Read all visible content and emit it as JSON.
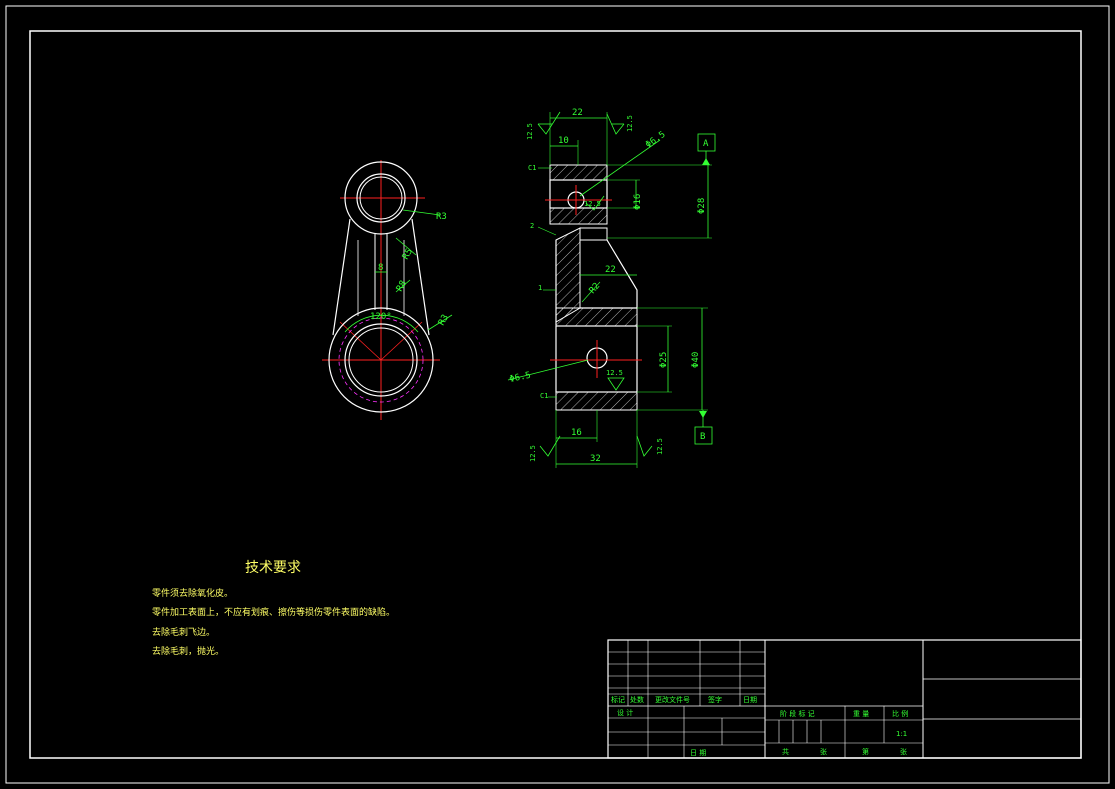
{
  "drawing": {
    "left_view": {
      "dimensions": {
        "radius_top": "R3",
        "radius_mid": "R5",
        "radius_lower": "R8",
        "radius_big": "R3",
        "web_width": "8",
        "angle": "120°"
      }
    },
    "right_view": {
      "dimensions": {
        "top_width": "22",
        "top_inner": "10",
        "hole_small": "Φ6.5",
        "hole_large": "Φ6.5",
        "bore_top": "Φ16",
        "outer_top": "Φ28",
        "bore_bottom": "Φ25",
        "outer_bottom": "Φ40",
        "mid_width": "22",
        "bottom_inner": "16",
        "bottom_width": "32",
        "radius_web": "R2",
        "chamfer_top": "C1",
        "chamfer_bottom": "C1",
        "step_top": "2",
        "step_mid": "1"
      },
      "roughness": {
        "r1": "12.5",
        "r2": "12.5",
        "r3": "12.5",
        "r4": "12.5",
        "r5": "12.5",
        "r6": "12.5"
      },
      "datums": {
        "upper": "A",
        "lower": "B"
      }
    }
  },
  "notes": {
    "title": "技术要求",
    "lines": [
      "零件须去除氧化皮。",
      "零件加工表面上，不应有划痕、擦伤等损伤零件表面的缺陷。",
      "去除毛刺飞边。",
      "去除毛刺，抛光。"
    ]
  },
  "title_block": {
    "row_labels": [
      "标记",
      "处数",
      "更改文件号",
      "签字",
      "日期"
    ],
    "designer": "设 计",
    "review": "审 核",
    "approve": "日 期",
    "stage": "阶 段 标 记",
    "weight": "重 量",
    "scale_label": "比 例",
    "scale_value": "1:1",
    "sheet_total": "共",
    "sheet_of": "张",
    "sheet_no": "第",
    "sheet_no2": "张"
  },
  "colors": {
    "outline": "#ffffff",
    "dimension": "#33ff33",
    "centerline": "#ff2020",
    "hidden": "#ff33ff",
    "notes": "#ffff66"
  }
}
